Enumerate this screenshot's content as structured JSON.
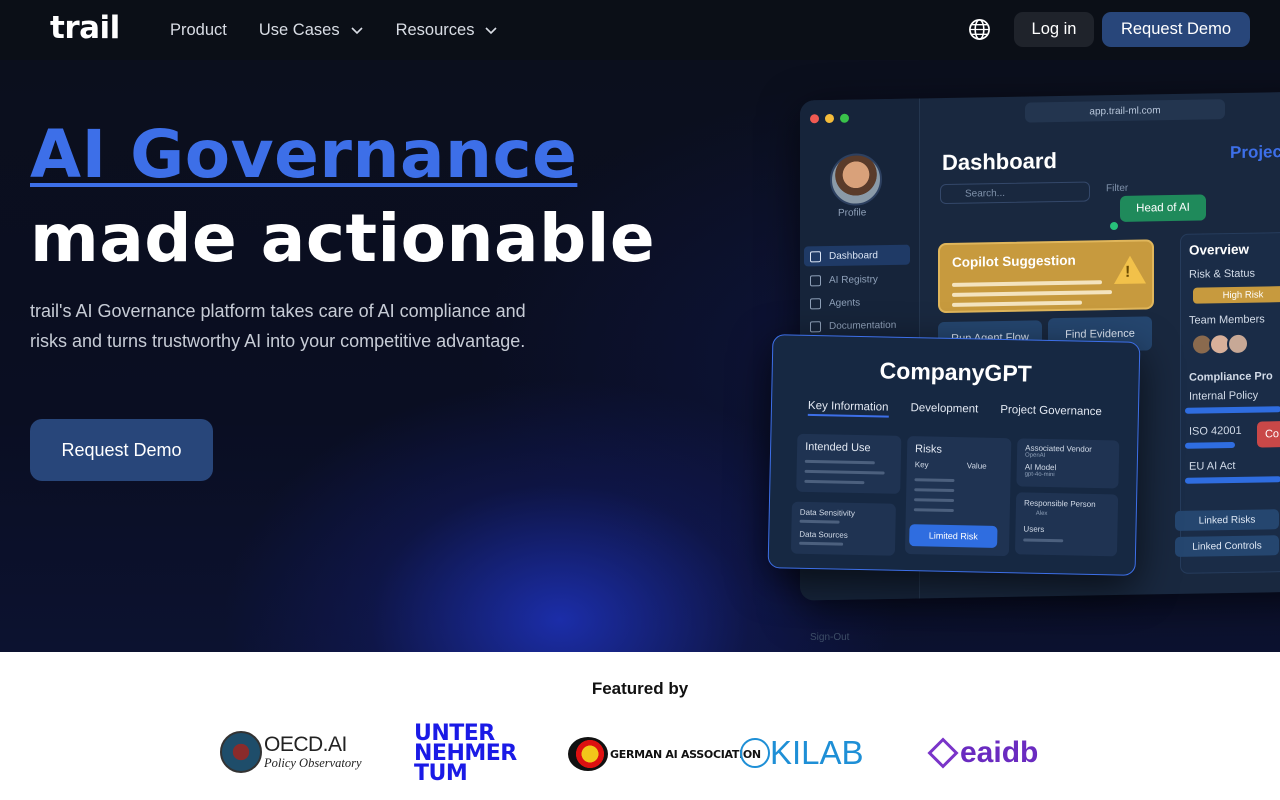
{
  "nav": {
    "logo": "trail",
    "links": [
      {
        "label": "Product",
        "has_dropdown": false
      },
      {
        "label": "Use Cases",
        "has_dropdown": true
      },
      {
        "label": "Resources",
        "has_dropdown": true
      }
    ],
    "language_icon": "globe-icon",
    "login_label": "Log in",
    "demo_label": "Request Demo"
  },
  "hero": {
    "title_highlight": "AI Governance",
    "title_rest": "made actionable",
    "description": "trail's AI Governance platform takes care of AI compliance and risks and turns trustworthy AI into your competitive advantage.",
    "cta_label": "Request Demo"
  },
  "mockup": {
    "url": "app.trail-ml.com",
    "profile_label": "Profile",
    "sidebar": [
      "Dashboard",
      "AI Registry",
      "Agents",
      "Documentation"
    ],
    "sign_out": "Sign-Out",
    "title": "Dashboard",
    "project_label": "Projec",
    "search_placeholder": "Search...",
    "filter_label": "Filter",
    "tag": "Head of AI",
    "copilot_title": "Copilot Suggestion",
    "actions": [
      "Run Agent Flow",
      "Find Evidence"
    ],
    "overview": {
      "title": "Overview",
      "risk_status": "Risk & Status",
      "risk_badge": "High Risk",
      "team_members": "Team Members",
      "compliance": "Compliance Pro",
      "policies": [
        "Internal Policy",
        "ISO 42001",
        "EU AI Act"
      ],
      "red_badge": "Co",
      "linked": [
        "Linked Risks",
        "Linked Controls"
      ]
    },
    "card": {
      "title": "CompanyGPT",
      "tabs": [
        "Key Information",
        "Development",
        "Project Governance"
      ],
      "intended_use": "Intended Use",
      "risks": "Risks",
      "risks_key": "Key",
      "risks_value": "Value",
      "limited_risk": "Limited Risk",
      "vendor_label": "Associated Vendor",
      "vendor_value": "OpenAI",
      "model_label": "AI Model",
      "model_value": "gpt-4o-mini",
      "person_label": "Responsible Person",
      "person_value": "Alex",
      "users_label": "Users",
      "data_sensitivity": "Data Sensitivity",
      "data_sources": "Data Sources"
    }
  },
  "featured": {
    "title": "Featured by",
    "logos": {
      "oecd_main": "OECD.AI",
      "oecd_sub": "Policy Observatory",
      "unter_l1": "UNTER",
      "unter_l2": "NEHMER",
      "unter_l3": "TUM",
      "gaia": "GERMAN AI ASSOCIATION",
      "kilab": "KILAB",
      "eaidb": "eaidb"
    }
  },
  "colors": {
    "accent": "#3d6fe8",
    "button": "#28467a",
    "nav_bg": "#0b0f17"
  }
}
